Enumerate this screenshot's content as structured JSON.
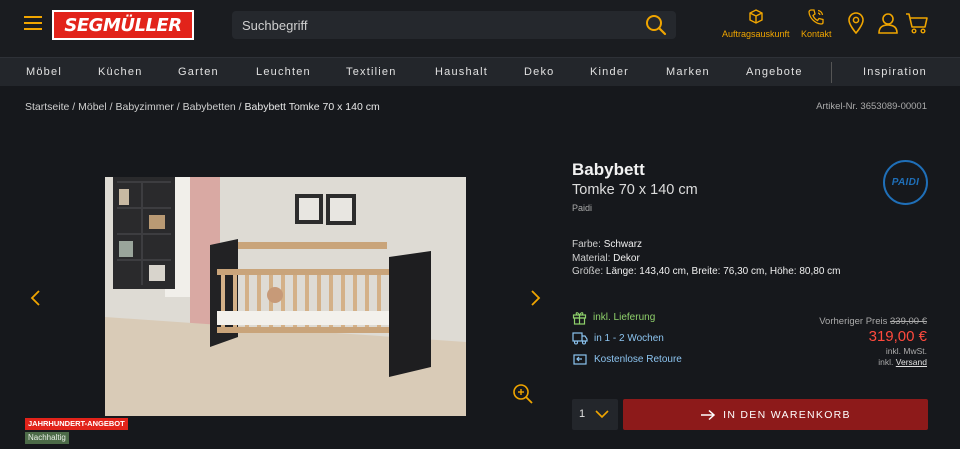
{
  "header": {
    "logo_text": "SEGMÜLLER",
    "search_placeholder": "Suchbegriff",
    "icons": {
      "order_status": {
        "icon": "box-icon",
        "label": "Auftragsauskunft"
      },
      "contact": {
        "icon": "phone-icon",
        "label": "Kontakt"
      },
      "stores": {
        "icon": "location-pin-icon"
      },
      "account": {
        "icon": "user-icon"
      },
      "cart": {
        "icon": "shopping-cart-icon"
      }
    },
    "accent_color": "#f0a500",
    "brand_color": "#e2231a"
  },
  "nav": {
    "items": [
      "Möbel",
      "Küchen",
      "Garten",
      "Leuchten",
      "Textilien",
      "Haushalt",
      "Deko",
      "Kinder",
      "Marken",
      "Angebote"
    ],
    "extra": "Inspiration"
  },
  "breadcrumb": {
    "items": [
      "Startseite",
      "Möbel",
      "Babyzimmer",
      "Babybetten"
    ],
    "current": "Babybett Tomke 70 x 140 cm"
  },
  "article_number": "Artikel-Nr.  3653089-00001",
  "gallery": {
    "badges": [
      "JAHRHUNDERT-ANGEBOT",
      "Nachhaltig"
    ]
  },
  "product": {
    "title": "Babybett",
    "subtitle": "Tomke 70 x 140 cm",
    "brand": "Paidi",
    "brand_logo_text": "PAIDI",
    "specs": [
      {
        "label": "Farbe:",
        "value": "Schwarz"
      },
      {
        "label": "Material:",
        "value": "Dekor"
      },
      {
        "label": "Größe:",
        "value": "Länge: 143,40 cm, Breite: 76,30 cm, Höhe: 80,80 cm"
      }
    ],
    "features": [
      {
        "icon": "gift-icon",
        "text": "inkl. Lieferung"
      },
      {
        "icon": "truck-icon",
        "text": "in 1 - 2 Wochen"
      },
      {
        "icon": "return-icon",
        "text": "Kostenlose Retoure"
      }
    ],
    "previous_price_label": "Vorheriger Preis",
    "previous_price": "339,00 €",
    "price": "319,00 €",
    "vat": "inkl. MwSt.",
    "shipping_prefix": "inkl.",
    "shipping_link": "Versand",
    "quantity": "1",
    "add_to_cart": "IN DEN WARENKORB"
  }
}
